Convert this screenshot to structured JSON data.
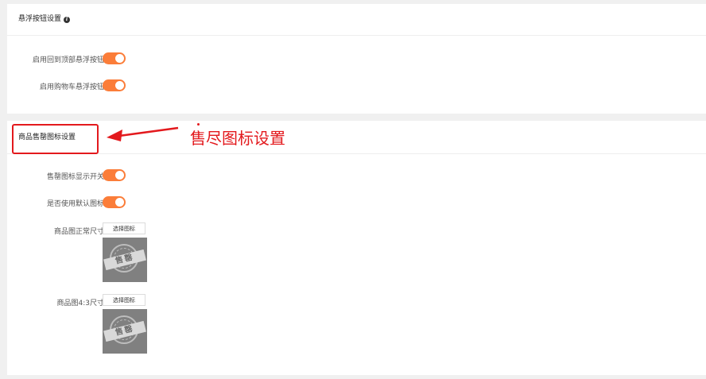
{
  "float_section": {
    "title": "悬浮按钮设置",
    "rows": [
      {
        "label": "启用回到顶部悬浮按钮",
        "enabled": true
      },
      {
        "label": "启用购物车悬浮按钮",
        "enabled": true
      }
    ]
  },
  "soldout_section": {
    "title": "商品售罄图标设置",
    "rows": [
      {
        "label": "售罄图标显示开关",
        "enabled": true
      },
      {
        "label": "是否使用默认图标",
        "enabled": true
      }
    ],
    "images": [
      {
        "label": "商品图正常尺寸",
        "button": "选择图标",
        "stamp_text": "售罄"
      },
      {
        "label": "商品图4:3尺寸",
        "button": "选择图标",
        "stamp_text": "售罄"
      }
    ]
  },
  "annotation": {
    "text": "售尽图标设置",
    "color": "#e3191d"
  },
  "colors": {
    "switch_on": "#fb7d39",
    "background": "#f0f0f0",
    "card": "#ffffff"
  },
  "icons": [
    "info-icon",
    "arrow-left-icon",
    "sold-out-stamp-icon"
  ]
}
